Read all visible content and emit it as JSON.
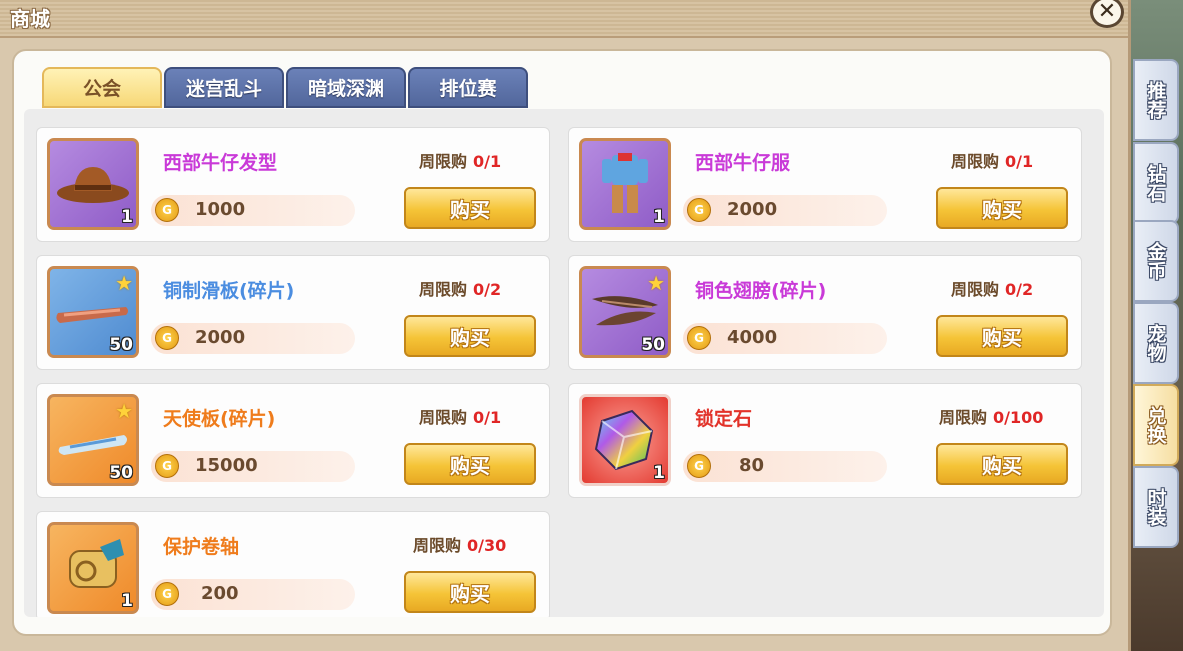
{
  "window": {
    "title": "商城"
  },
  "tabs": [
    {
      "label": "公会",
      "active": true
    },
    {
      "label": "迷宫乱斗",
      "active": false
    },
    {
      "label": "暗域深渊",
      "active": false
    },
    {
      "label": "排位赛",
      "active": false
    }
  ],
  "side_tabs": [
    {
      "label": "推荐",
      "active": false
    },
    {
      "label": "钻石",
      "active": false
    },
    {
      "label": "金币",
      "active": false
    },
    {
      "label": "宠物",
      "active": false
    },
    {
      "label": "兑换",
      "active": true
    },
    {
      "label": "时装",
      "active": false
    }
  ],
  "buy_label": "购买",
  "items": [
    {
      "name": "西部牛仔发型",
      "limit_label": "周限购",
      "limit": "0/1",
      "price": "1000",
      "qty": "1",
      "name_color": "#c93ad8",
      "icon": "cowboy-hat-icon"
    },
    {
      "name": "西部牛仔服",
      "limit_label": "周限购",
      "limit": "0/1",
      "price": "2000",
      "qty": "1",
      "name_color": "#c93ad8",
      "icon": "cowboy-outfit-icon"
    },
    {
      "name": "铜制滑板(碎片)",
      "limit_label": "周限购",
      "limit": "0/2",
      "price": "2000",
      "qty": "50",
      "name_color": "#4b8de0",
      "icon": "skateboard-icon"
    },
    {
      "name": "铜色翅膀(碎片)",
      "limit_label": "周限购",
      "limit": "0/2",
      "price": "4000",
      "qty": "50",
      "name_color": "#c93ad8",
      "icon": "wings-icon"
    },
    {
      "name": "天使板(碎片)",
      "limit_label": "周限购",
      "limit": "0/1",
      "price": "15000",
      "qty": "50",
      "name_color": "#ef7c1c",
      "icon": "angel-board-icon"
    },
    {
      "name": "锁定石",
      "limit_label": "周限购",
      "limit": "0/100",
      "price": "80",
      "qty": "1",
      "name_color": "#e2332a",
      "icon": "lock-stone-icon"
    },
    {
      "name": "保护卷轴",
      "limit_label": "周限购",
      "limit": "0/30",
      "price": "200",
      "qty": "1",
      "name_color": "#ef7c1c",
      "icon": "scroll-icon"
    }
  ]
}
